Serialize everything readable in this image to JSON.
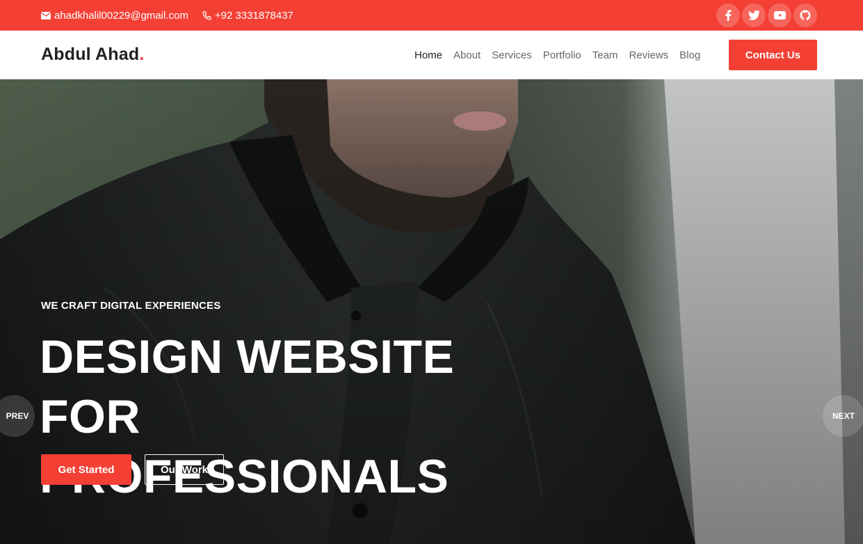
{
  "topbar": {
    "email": "ahadkhalil00229@gmail.com",
    "phone": "+92 3331878437",
    "socials": [
      "facebook-icon",
      "twitter-icon",
      "youtube-icon",
      "github-icon"
    ]
  },
  "header": {
    "logo_text": "Abdul Ahad",
    "logo_dot": ".",
    "nav": [
      "Home",
      "About",
      "Services",
      "Portfolio",
      "Team",
      "Reviews",
      "Blog"
    ],
    "active_nav": "Home",
    "cta_label": "Contact Us"
  },
  "hero": {
    "subtitle": "WE CRAFT DIGITAL EXPERIENCES",
    "title_line1": "DESIGN WEBSITE FOR",
    "title_line2": "PROFESSIONALS",
    "primary_button": "Get Started",
    "secondary_button": "Our Work",
    "prev_label": "PREV",
    "next_label": "NEXT"
  },
  "colors": {
    "accent": "#f43f34",
    "text_dark": "#222222",
    "nav_text": "#666666"
  }
}
